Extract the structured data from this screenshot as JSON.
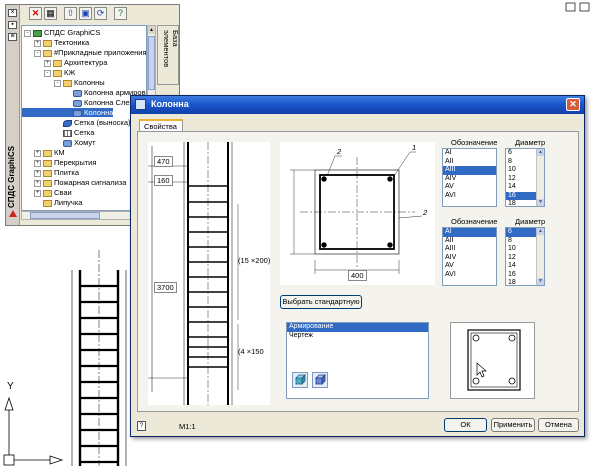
{
  "palette": {
    "side_title": "СПДС GraphiCS",
    "vertical_tab": "База элементов",
    "toolbar": [
      "close",
      "delete",
      "up",
      "view",
      "refresh",
      "help"
    ],
    "tree": [
      {
        "label": "СПДС GraphiCS",
        "indent": 0,
        "icon": "db",
        "exp": "-"
      },
      {
        "label": "Тектоника",
        "indent": 1,
        "icon": "folder",
        "exp": "+"
      },
      {
        "label": "#Прикладные приложения",
        "indent": 1,
        "icon": "folder",
        "exp": "-"
      },
      {
        "label": "Архитектура",
        "indent": 2,
        "icon": "folder",
        "exp": "+"
      },
      {
        "label": "КЖ",
        "indent": 2,
        "icon": "folder",
        "exp": "-"
      },
      {
        "label": "Колонны",
        "indent": 3,
        "icon": "folder",
        "exp": "-"
      },
      {
        "label": "Колонна армиров",
        "indent": 4,
        "icon": "gear",
        "exp": ""
      },
      {
        "label": "Колонна Сле",
        "indent": 4,
        "icon": "gear",
        "exp": ""
      },
      {
        "label": "Колонна",
        "indent": 4,
        "icon": "gear",
        "exp": "",
        "selected": true
      },
      {
        "label": "Сетка (выноска)",
        "indent": 3,
        "icon": "pen",
        "exp": ""
      },
      {
        "label": "Сетка",
        "indent": 3,
        "icon": "grid",
        "exp": ""
      },
      {
        "label": "Хомут",
        "indent": 3,
        "icon": "gear",
        "exp": ""
      },
      {
        "label": "КМ",
        "indent": 1,
        "icon": "folder",
        "exp": "+"
      },
      {
        "label": "Перекрытия",
        "indent": 1,
        "icon": "folder",
        "exp": "+"
      },
      {
        "label": "Плитка",
        "indent": 1,
        "icon": "folder",
        "exp": "+"
      },
      {
        "label": "Пожарная сигнализа",
        "indent": 1,
        "icon": "folder",
        "exp": "+"
      },
      {
        "label": "Сваи",
        "indent": 1,
        "icon": "folder",
        "exp": "+"
      },
      {
        "label": "Липучка",
        "indent": 1,
        "icon": "folder",
        "exp": ""
      }
    ]
  },
  "dialog": {
    "title": "Колонна",
    "close_label": "✕",
    "tab_label": "Свойства",
    "elevation": {
      "dim_top": "470",
      "dim_2": "160",
      "dim_3": "3700",
      "note_1": "(15 ×200)",
      "note_2": "(4 ×150"
    },
    "plan": {
      "callout_1": "1",
      "callout_2": "2",
      "callout_3": "2",
      "dim_width": "400"
    },
    "table1": {
      "col1_header": "Обозначение",
      "col2_header": "Диаметр",
      "grades": [
        "AI",
        "AII",
        "AIII",
        "AIV",
        "AV",
        "AVI"
      ],
      "grades_selected": 2,
      "diameters": [
        "6",
        "8",
        "10",
        "12",
        "14",
        "16",
        "18"
      ],
      "diameters_selected": 5
    },
    "table2": {
      "col1_header": "Обозначение",
      "col2_header": "Диаметр",
      "grades": [
        "AI",
        "AII",
        "AIII",
        "AIV",
        "AV",
        "AVI"
      ],
      "grades_selected": 0,
      "diameters": [
        "6",
        "8",
        "10",
        "12",
        "14",
        "16",
        "18"
      ],
      "diameters_selected": 0
    },
    "select_standard_label": "Выбрать стандартную",
    "layers": {
      "items": [
        "Армирование",
        "Чертеж"
      ],
      "selected": 0
    },
    "status": {
      "scale": "M1:1"
    },
    "buttons": {
      "ok": "ОК",
      "apply": "Применить",
      "cancel": "Отмена"
    }
  },
  "cad": {
    "axis_y_label": "Y"
  }
}
